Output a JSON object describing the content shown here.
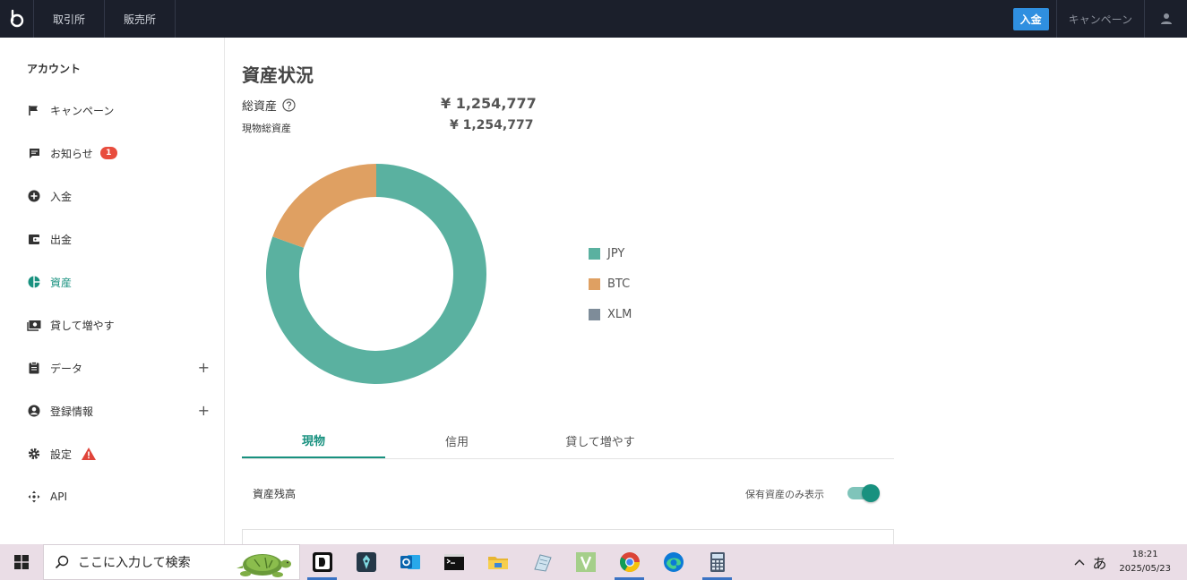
{
  "header": {
    "nav_tabs": [
      "取引所",
      "販売所"
    ],
    "deposit_button": "入金",
    "campaign_link": "キャンペーン"
  },
  "sidebar": {
    "title": "アカウント",
    "items": [
      {
        "label": "キャンペーン",
        "icon": "flag-icon"
      },
      {
        "label": "お知らせ",
        "icon": "message-icon",
        "badge": "1"
      },
      {
        "label": "入金",
        "icon": "plus-circle-icon"
      },
      {
        "label": "出金",
        "icon": "wallet-icon"
      },
      {
        "label": "資産",
        "icon": "pie-chart-icon",
        "active": true
      },
      {
        "label": "貸して増やす",
        "icon": "money-icon"
      },
      {
        "label": "データ",
        "icon": "clipboard-icon",
        "expandable": true
      },
      {
        "label": "登録情報",
        "icon": "account-circle-icon",
        "expandable": true
      },
      {
        "label": "設定",
        "icon": "gear-icon",
        "warning": true
      },
      {
        "label": "API",
        "icon": "api-icon"
      }
    ]
  },
  "main": {
    "title": "資産状況",
    "total_label": "総資産",
    "total_value": "¥ 1,254,777",
    "spot_label": "現物総資産",
    "spot_value": "¥ 1,254,777",
    "tabs": [
      "現物",
      "信用",
      "貸して増やす"
    ],
    "active_tab": 0,
    "balance_label": "資産残高",
    "toggle_label": "保有資産のみ表示",
    "toggle_on": true
  },
  "chart_data": {
    "type": "pie",
    "donut": true,
    "categories": [
      "JPY",
      "BTC",
      "XLM"
    ],
    "values": [
      80.5,
      19.5,
      0
    ],
    "colors": [
      "#5ab1a0",
      "#dfa062",
      "#7e8c99"
    ],
    "legend_position": "right"
  },
  "taskbar": {
    "search_placeholder": "ここに入力して検索",
    "apps": [
      {
        "icon": "dolby-icon",
        "running": true
      },
      {
        "icon": "pen-app-icon",
        "running": false
      },
      {
        "icon": "outlook-icon",
        "running": false
      },
      {
        "icon": "terminal-icon",
        "running": false
      },
      {
        "icon": "file-explorer-icon",
        "running": false
      },
      {
        "icon": "notepad-icon",
        "running": false
      },
      {
        "icon": "v-app-icon",
        "running": false
      },
      {
        "icon": "chrome-icon",
        "running": true
      },
      {
        "icon": "edge-icon",
        "running": false
      },
      {
        "icon": "calculator-icon",
        "running": true
      }
    ],
    "ime": "あ",
    "time": "18:21",
    "date": "2025/05/23"
  }
}
